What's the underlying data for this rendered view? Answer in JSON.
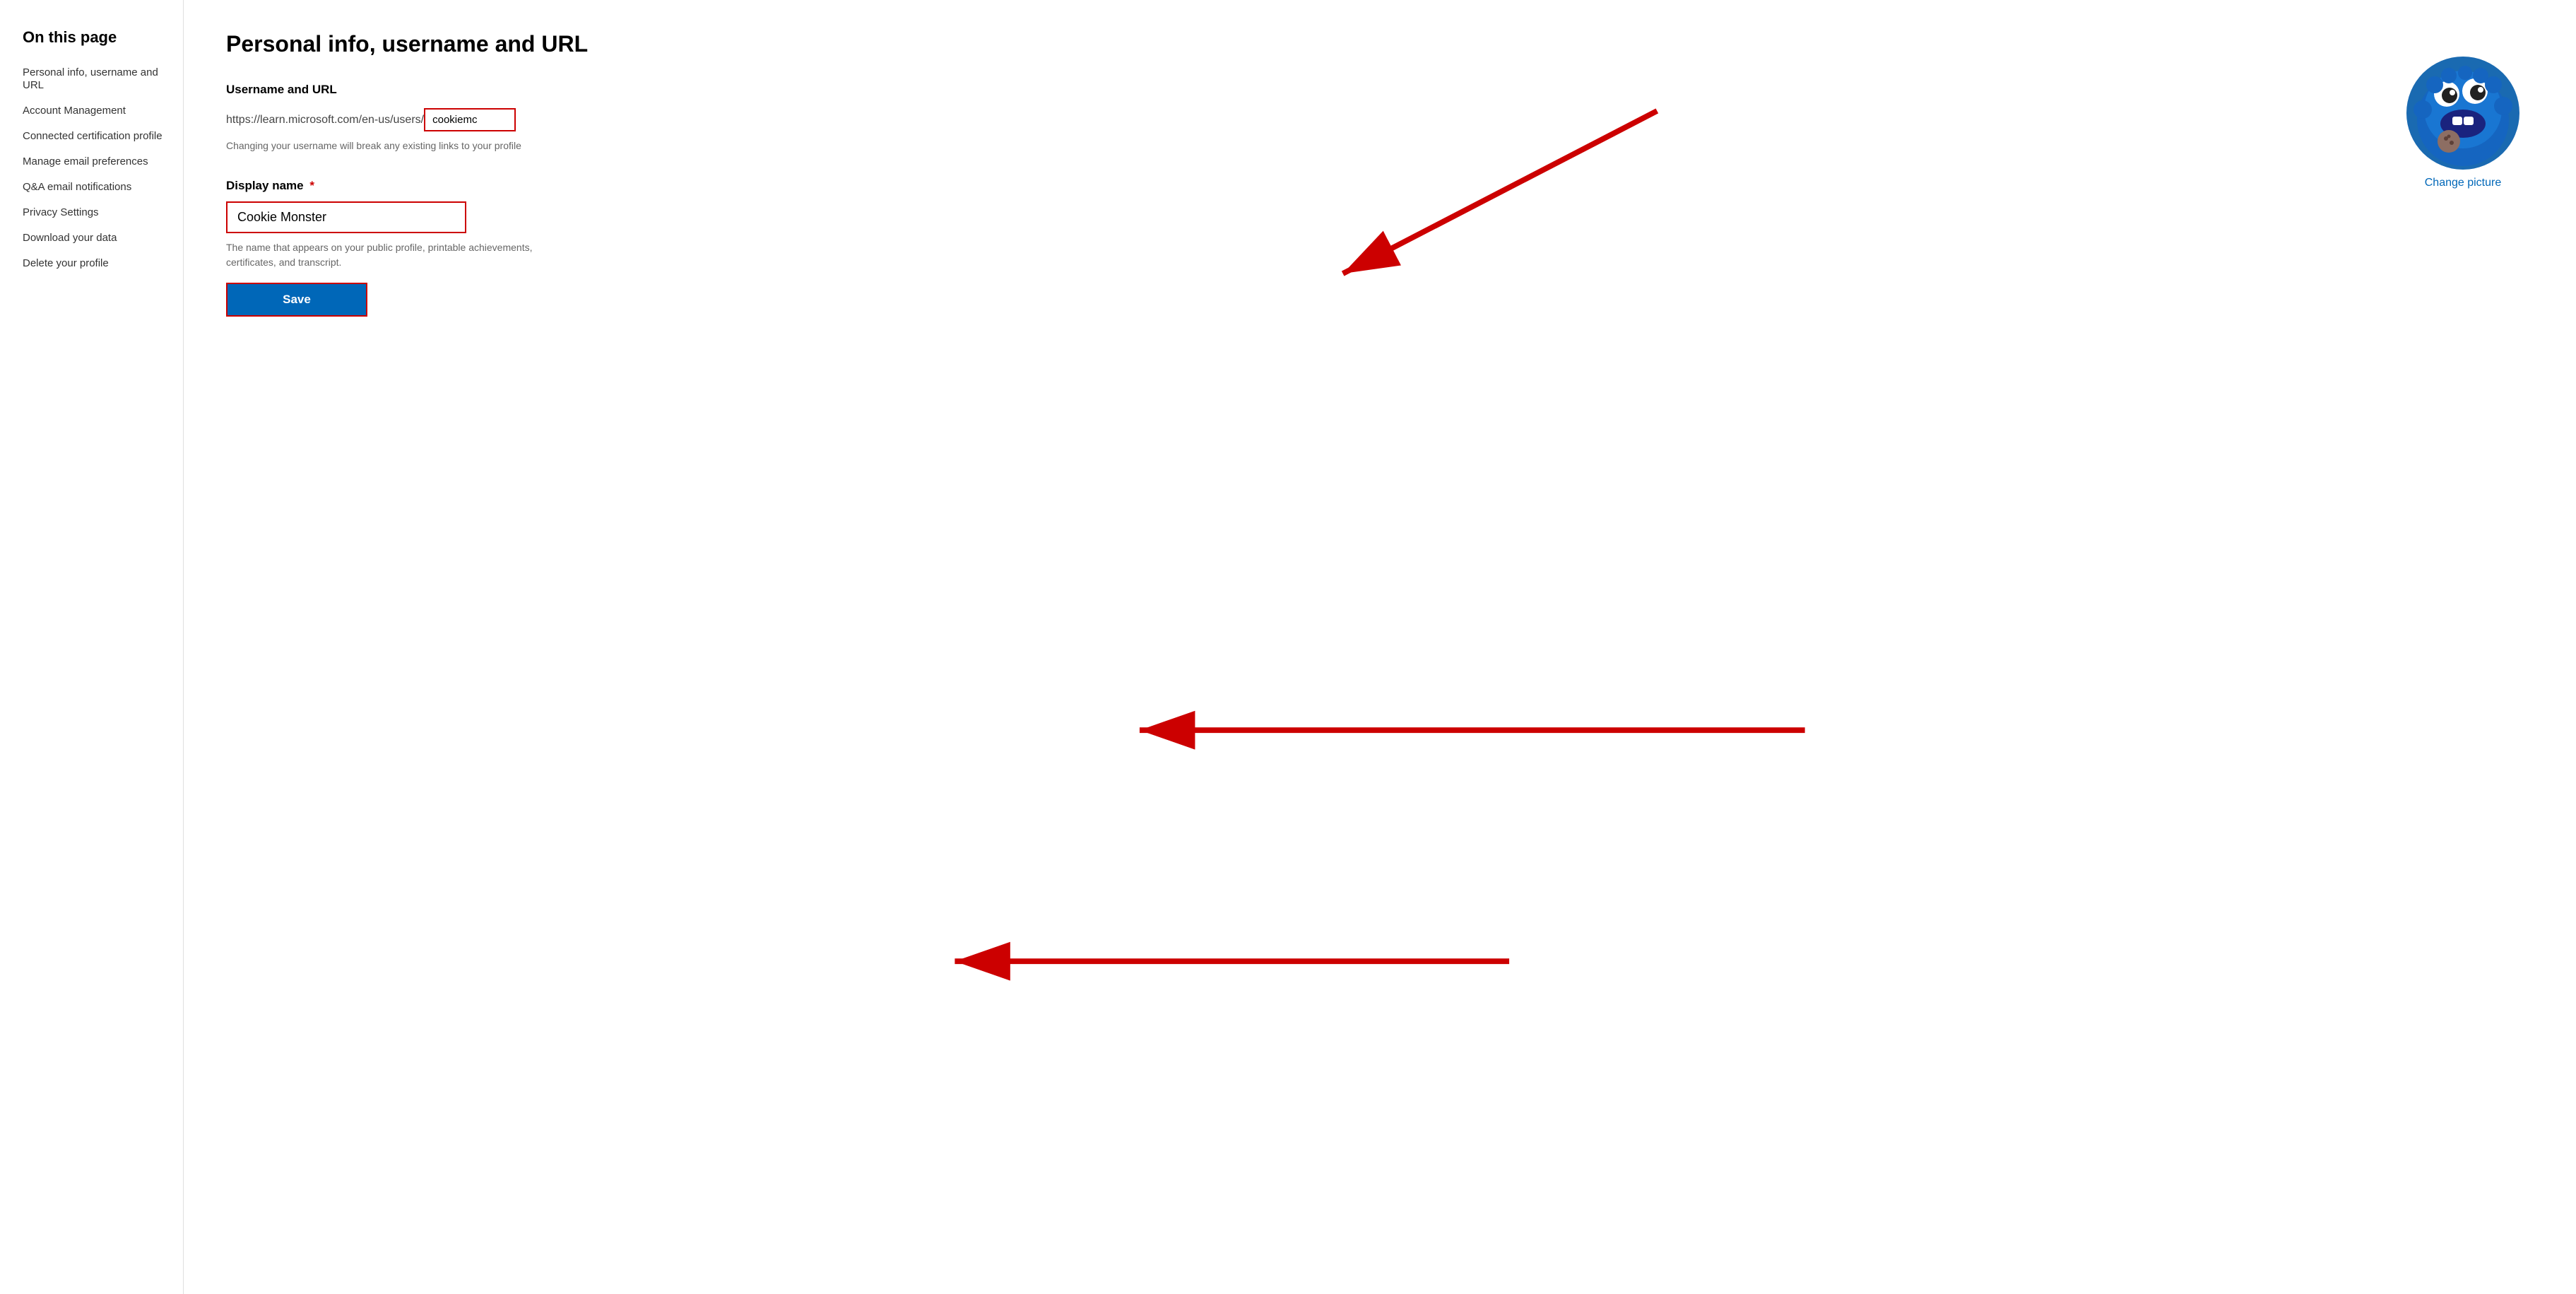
{
  "sidebar": {
    "title": "On this page",
    "items": [
      {
        "label": "Personal info, username and URL",
        "id": "personal-info"
      },
      {
        "label": "Account Management",
        "id": "account-management"
      },
      {
        "label": "Connected certification profile",
        "id": "connected-cert"
      },
      {
        "label": "Manage email preferences",
        "id": "email-prefs"
      },
      {
        "label": "Q&A email notifications",
        "id": "qa-notifications"
      },
      {
        "label": "Privacy Settings",
        "id": "privacy-settings"
      },
      {
        "label": "Download your data",
        "id": "download-data"
      },
      {
        "label": "Delete your profile",
        "id": "delete-profile"
      }
    ]
  },
  "main": {
    "page_heading": "Personal info, username and URL",
    "username_section": {
      "label": "Username and URL",
      "url_prefix": "https://learn.microsoft.com/en-us/users/",
      "username_value": "cookiemc",
      "hint": "Changing your username will break any existing links to your profile"
    },
    "display_name_section": {
      "label": "Display name",
      "required_marker": "*",
      "value": "Cookie Monster",
      "hint": "The name that appears on your public profile, printable achievements, certificates, and transcript."
    },
    "save_button": {
      "label": "Save"
    },
    "avatar": {
      "change_picture_label": "Change picture"
    }
  }
}
